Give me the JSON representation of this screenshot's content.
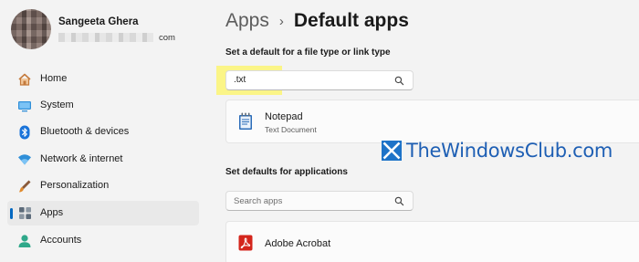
{
  "profile": {
    "name": "Sangeeta Ghera",
    "email_domain": "com"
  },
  "sidebar": {
    "items": [
      {
        "label": "Home",
        "icon": "home-icon"
      },
      {
        "label": "System",
        "icon": "system-icon"
      },
      {
        "label": "Bluetooth & devices",
        "icon": "bluetooth-icon"
      },
      {
        "label": "Network & internet",
        "icon": "network-icon"
      },
      {
        "label": "Personalization",
        "icon": "personalization-icon"
      },
      {
        "label": "Apps",
        "icon": "apps-icon",
        "active": true
      },
      {
        "label": "Accounts",
        "icon": "accounts-icon"
      }
    ]
  },
  "breadcrumb": {
    "parent": "Apps",
    "separator": "›",
    "current": "Default apps"
  },
  "file_type_section": {
    "label": "Set a default for a file type or link type",
    "search_value": ".txt",
    "result": {
      "title": "Notepad",
      "subtitle": "Text Document",
      "icon": "notepad-icon"
    }
  },
  "apps_section": {
    "label": "Set defaults for applications",
    "search_placeholder": "Search apps",
    "first_app": {
      "title": "Adobe Acrobat",
      "icon": "adobe-acrobat-icon"
    }
  },
  "watermark": {
    "text": "TheWindowsClub.com"
  },
  "colors": {
    "accent": "#0067c0",
    "highlight": "#fbf587",
    "watermark": "#1e5fb4",
    "acrobat": "#d4261c"
  }
}
